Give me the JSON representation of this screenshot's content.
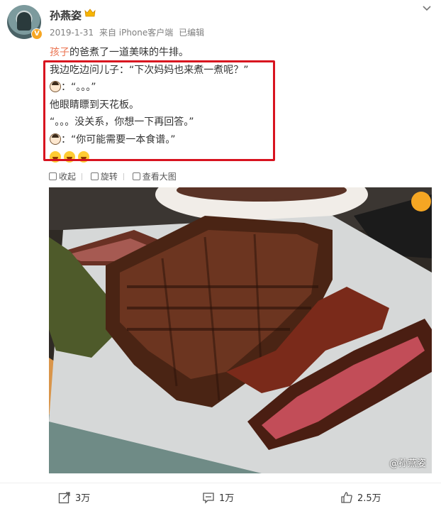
{
  "post": {
    "author": "孙燕姿",
    "date": "2019-1-31",
    "source": "来自 iPhone客户端",
    "edited": "已编辑",
    "line1_link": "孩子",
    "line1_rest": "的爸煮了一道美味的牛排。",
    "line2": "我边吃边问儿子：“下次妈妈也来煮一煮呢？”",
    "line3": "：“。。。”",
    "line4": "他眼睛瞟到天花板。",
    "line5": "“。。。没关系，你想一下再回答。”",
    "line6": "：“你可能需要一本食谱。”"
  },
  "media_toolbar": {
    "collect": "收起",
    "rotate": "旋转",
    "view_large": "查看大图"
  },
  "photo": {
    "watermark": "@孙燕姿"
  },
  "actions": {
    "share": "3万",
    "comment": "1万",
    "like": "2.5万"
  }
}
